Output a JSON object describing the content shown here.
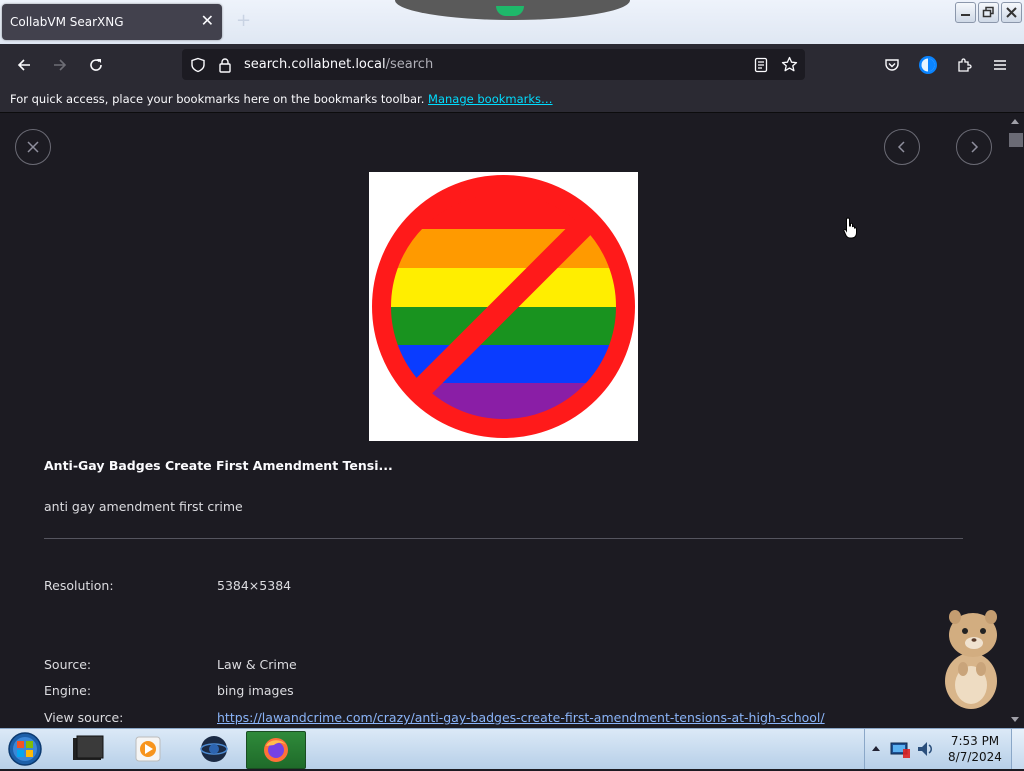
{
  "browser": {
    "tab_title": "CollabVM SearXNG",
    "tab_close": "✕",
    "new_tab": "+",
    "url_host": "search.collabnet.local",
    "url_path": "/search"
  },
  "bookmarks_bar": {
    "message": "For quick access, place your bookmarks here on the bookmarks toolbar.",
    "manage_link": "Manage bookmarks…"
  },
  "result": {
    "title": "Anti-Gay Badges Create First Amendment Tensi...",
    "description": "anti gay amendment first crime",
    "details": [
      {
        "label": "Resolution:",
        "value": "5384×5384"
      },
      {
        "label": "Source:",
        "value": "Law & Crime"
      },
      {
        "label": "Engine:",
        "value": "bing images"
      },
      {
        "label": "View source:",
        "value": "https://lawandcrime.com/crazy/anti-gay-badges-create-first-amendment-tensions-at-high-school/"
      }
    ]
  },
  "taskbar": {
    "time": "7:53 PM",
    "date": "8/7/2024"
  },
  "icons": [
    "close-icon",
    "back-icon",
    "forward-icon",
    "reload-icon",
    "shield-icon",
    "lock-icon",
    "reader-view-icon",
    "star-icon",
    "pocket-icon",
    "account-icon",
    "extensions-icon",
    "menu-icon",
    "prev-icon",
    "next-icon"
  ],
  "colors": {
    "accent": "#00ddff",
    "link": "#8ab4f8",
    "background": "#1c1b22",
    "toolbar": "#2b2a33"
  }
}
